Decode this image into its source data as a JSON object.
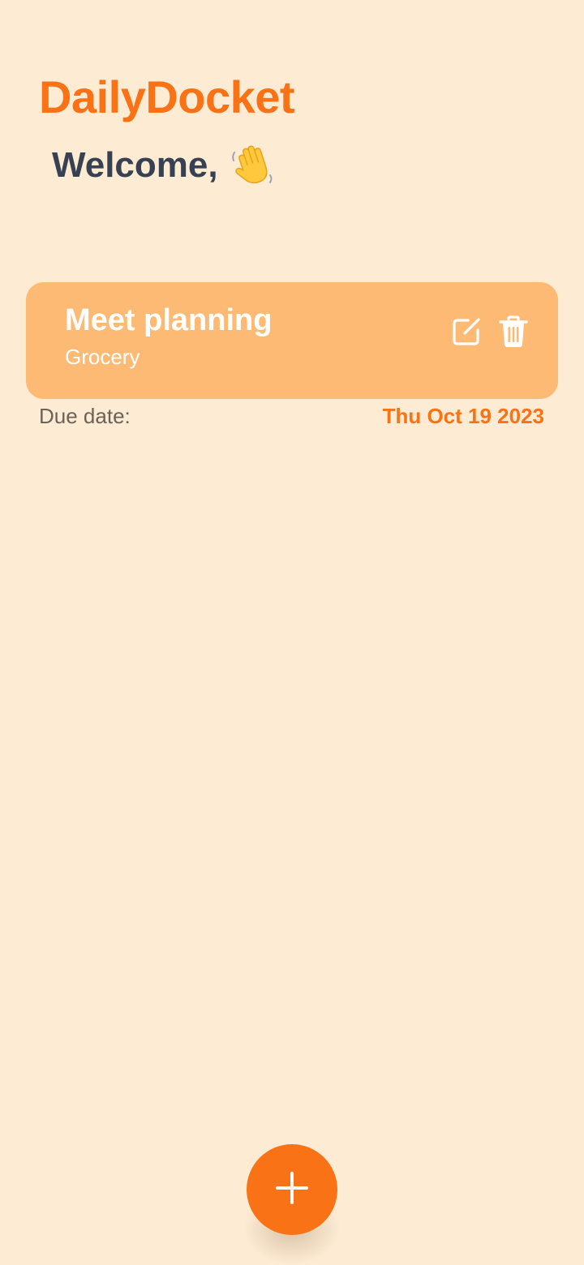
{
  "app": {
    "title": "DailyDocket",
    "welcome_text": "Welcome,",
    "welcome_icon": "waving-hand-icon"
  },
  "tasks": [
    {
      "title": "Meet planning",
      "category": "Grocery",
      "due_label": "Due date:",
      "due_date": "Thu Oct 19 2023",
      "actions": {
        "edit_icon": "edit-icon",
        "delete_icon": "trash-icon"
      }
    }
  ],
  "fab": {
    "icon": "plus-icon"
  },
  "colors": {
    "background": "#FDEBD3",
    "accent": "#F97316",
    "card": "#FDBA74",
    "heading": "#374151"
  }
}
